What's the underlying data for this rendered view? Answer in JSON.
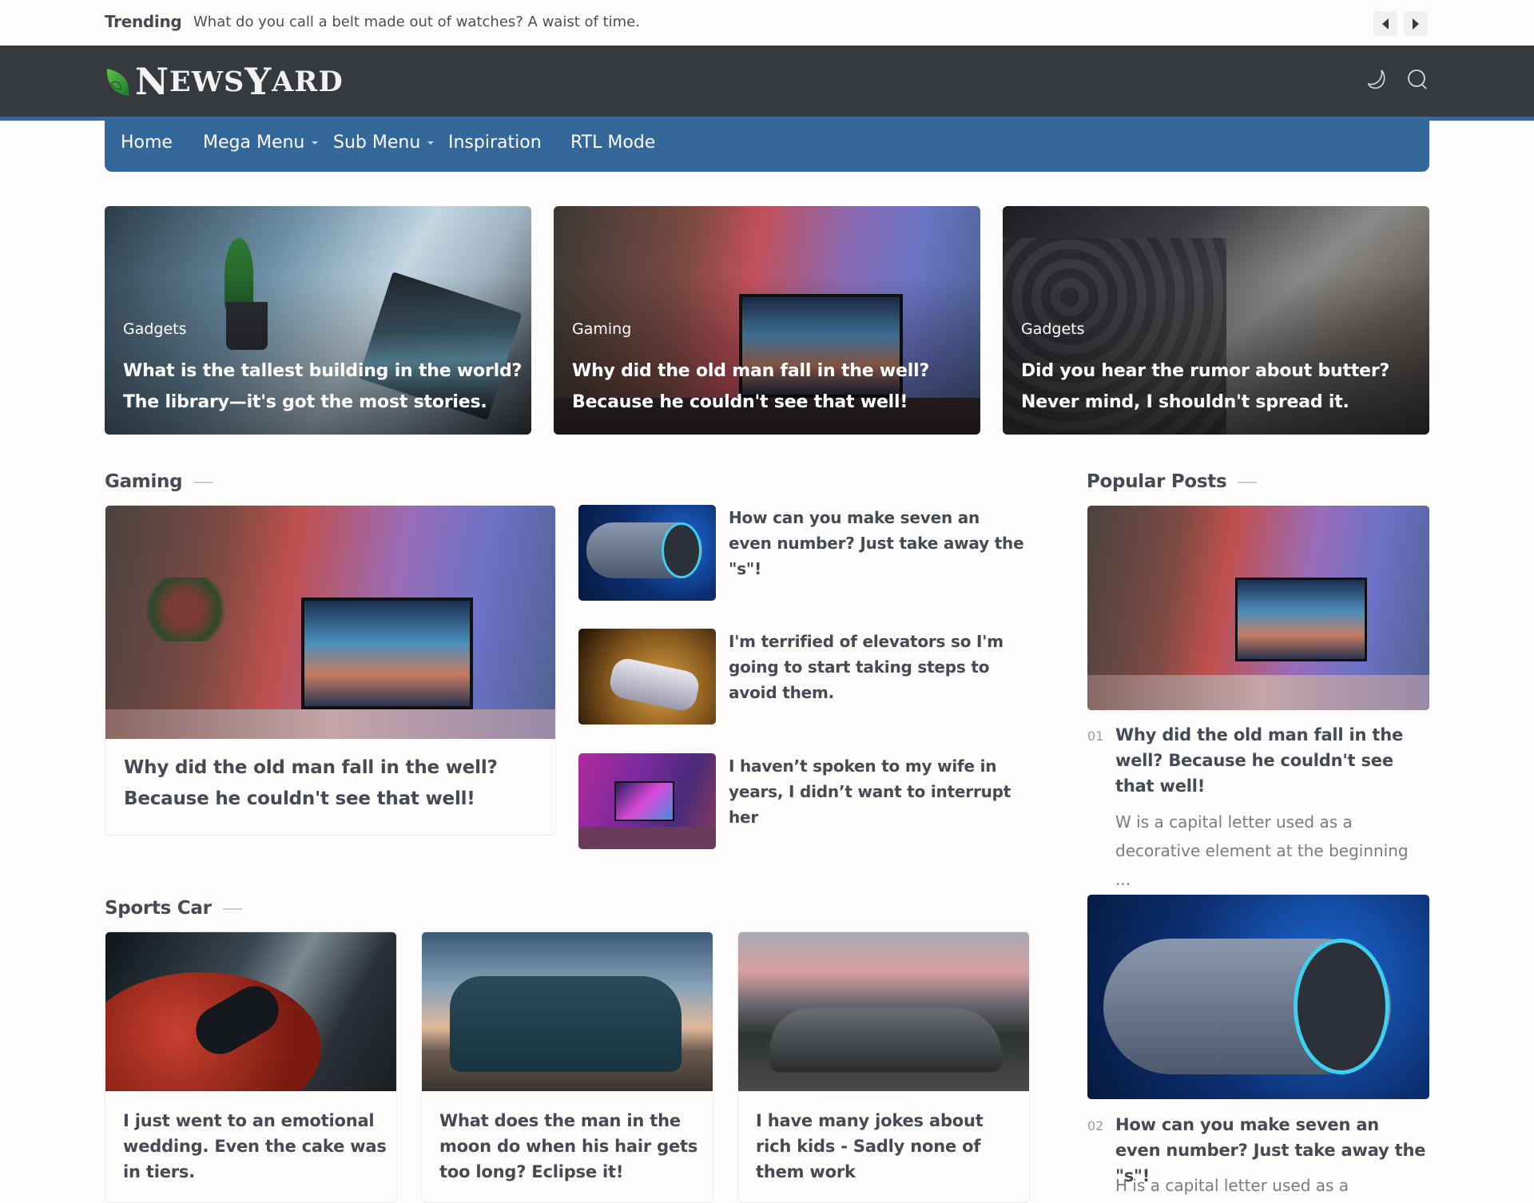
{
  "trending": {
    "label": "Trending",
    "text": "What do you call a belt made out of watches? A waist of time.",
    "prev_icon": "caret-left-icon",
    "next_icon": "caret-right-icon"
  },
  "header": {
    "logo_text_first": "N",
    "logo_text_rest1": "EWS",
    "logo_text_y": "Y",
    "logo_text_rest2": "ARD",
    "icons": [
      "moon-icon",
      "search-icon"
    ]
  },
  "nav": {
    "items": [
      {
        "label": "Home",
        "dropdown": false
      },
      {
        "label": "Mega Menu",
        "dropdown": true
      },
      {
        "label": "Sub Menu",
        "dropdown": true
      },
      {
        "label": "Inspiration",
        "dropdown": false
      },
      {
        "label": "RTL Mode",
        "dropdown": false
      }
    ]
  },
  "hero": [
    {
      "category": "Gadgets",
      "title": "What is the tallest building in the world? The library—it's got the most stories."
    },
    {
      "category": "Gaming",
      "title": "Why did the old man fall in the well? Because he couldn't see that well!"
    },
    {
      "category": "Gadgets",
      "title": "Did you hear the rumor about butter? Never mind, I shouldn't spread it."
    }
  ],
  "gaming": {
    "heading": "Gaming",
    "featured": {
      "title": "Why did the old man fall in the well? Because he couldn't see that well!"
    },
    "list": [
      {
        "title": "How can you make seven an even number? Just take away the \"s\"!"
      },
      {
        "title": "I'm terrified of elevators so I'm going to start taking steps to avoid them."
      },
      {
        "title": "I haven’t spoken to my wife in years, I didn’t want to interrupt her"
      }
    ]
  },
  "popular": {
    "heading": "Popular Posts",
    "items": [
      {
        "number": "01",
        "title": "Why did the old man fall in the well? Because he couldn't see that well!",
        "excerpt": "W is a capital letter used as a decorative element at the beginning ..."
      },
      {
        "number": "02",
        "title": "How can you make seven an even number? Just take away the \"s\"!",
        "excerpt": "H is a capital letter used as a"
      }
    ]
  },
  "sports": {
    "heading": "Sports Car",
    "cards": [
      {
        "title": "I just went to an emotional wedding. Even the cake was in tiers."
      },
      {
        "title": "What does the man in the moon do when his hair gets too long? Eclipse it!"
      },
      {
        "title": "I have many jokes about rich kids - Sadly none of them work"
      }
    ]
  }
}
